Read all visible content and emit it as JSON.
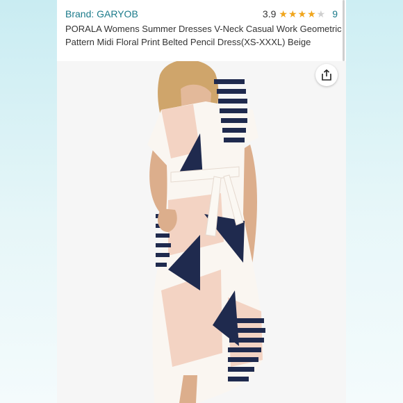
{
  "product": {
    "brand": "Brand: GARYOB",
    "rating_value": "3.9",
    "rating_stars": 3.9,
    "review_count": "9",
    "title": "PORALA Womens Summer Dresses V-Neck Casual Work Geometric Pattern Midi Floral Print Belted Pencil Dress(XS-XXXL) Beige"
  },
  "icons": {
    "share": "share-icon",
    "star": "star-icon"
  },
  "colors": {
    "brand_link": "#1a7a8a",
    "star_full": "#f0a51c",
    "star_empty": "#cfcfcf",
    "dress_pink": "#f3d3c3",
    "dress_navy": "#1f2a4e",
    "dress_cream": "#faf6f1"
  }
}
